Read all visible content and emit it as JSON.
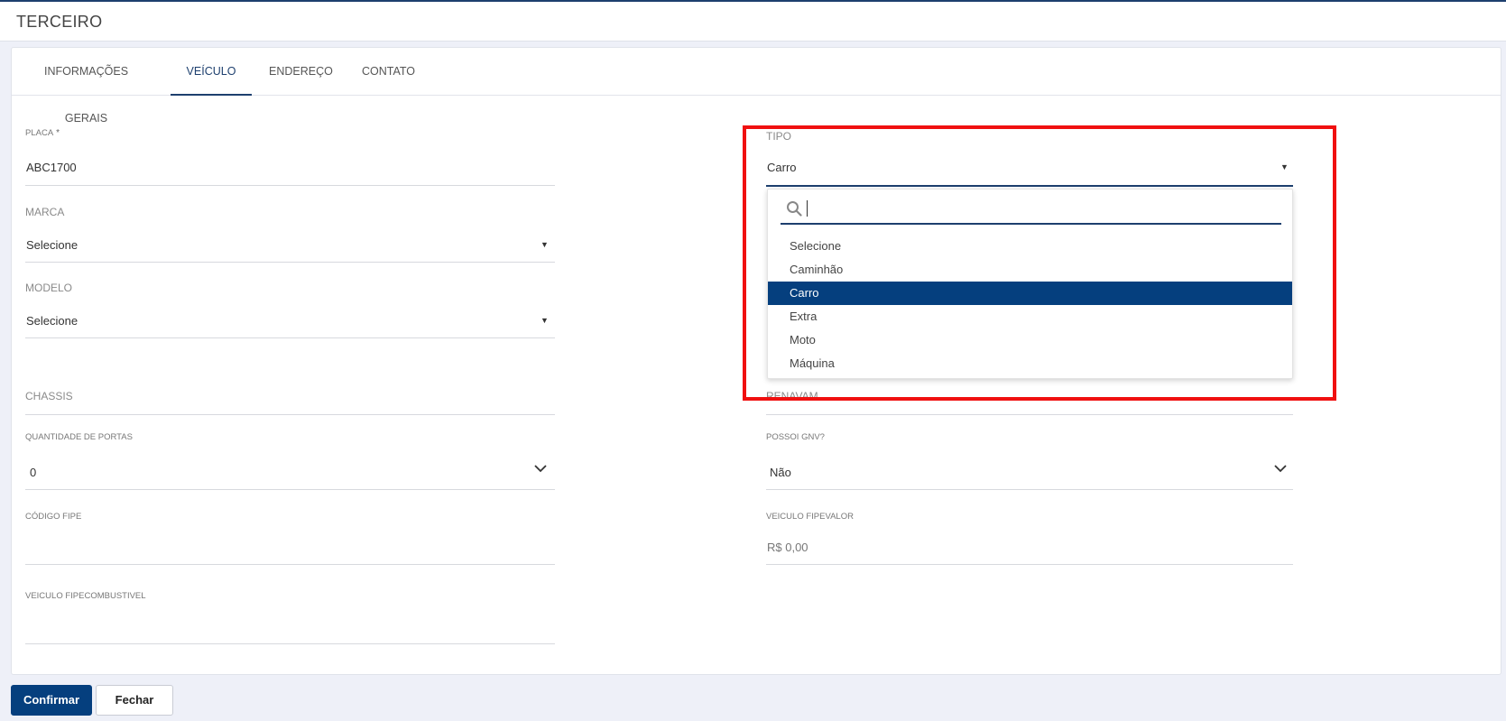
{
  "header": {
    "title": "TERCEIRO"
  },
  "tabs": [
    {
      "label": "INFORMAÇÕES GERAIS"
    },
    {
      "label": "VEÍCULO"
    },
    {
      "label": "ENDEREÇO"
    },
    {
      "label": "CONTATO"
    }
  ],
  "form": {
    "placa": {
      "label": "PLACA",
      "required_mark": "*",
      "value": "ABC1700"
    },
    "marca": {
      "label": "MARCA",
      "value": "Selecione"
    },
    "modelo": {
      "label": "MODELO",
      "value": "Selecione"
    },
    "chassis": {
      "label": "CHASSIS",
      "value": ""
    },
    "quantidade_portas": {
      "label": "QUANTIDADE DE PORTAS",
      "value": "0"
    },
    "codigo_fipe": {
      "label": "CÓDIGO FIPE",
      "value": ""
    },
    "veiculo_fipecombustivel": {
      "label": "VEICULO FIPECOMBUSTIVEL",
      "value": ""
    },
    "tipo": {
      "label": "TIPO",
      "value": "Carro"
    },
    "renavam": {
      "label": "RENAVAM",
      "value": ""
    },
    "possui_gnv": {
      "label": "POSSOI GNV?",
      "value": "Não"
    },
    "veiculo_fipevalor": {
      "label": "VEICULO FIPEVALOR",
      "value": "R$ 0,00"
    }
  },
  "tipo_dropdown": {
    "search_value": "",
    "options": [
      "Selecione",
      "Caminhão",
      "Carro",
      "Extra",
      "Moto",
      "Máquina"
    ],
    "selected": "Carro"
  },
  "buttons": {
    "confirm": "Confirmar",
    "close": "Fechar"
  },
  "colors": {
    "primary": "#053f7e",
    "highlight_box": "#f01010"
  }
}
